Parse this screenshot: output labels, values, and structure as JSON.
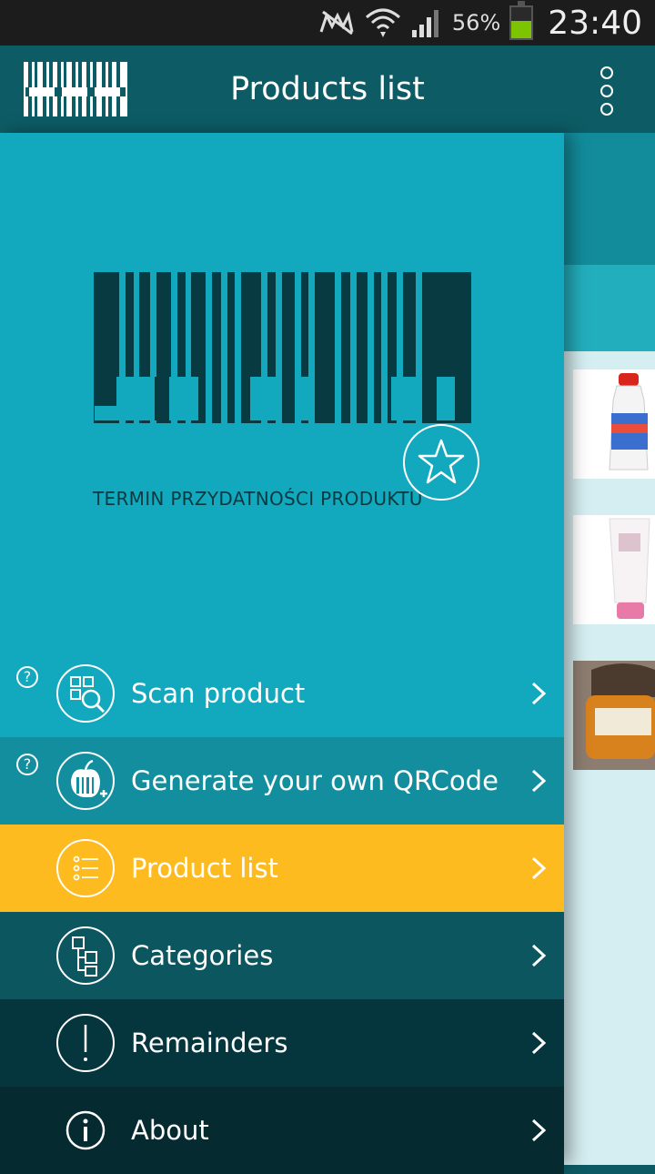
{
  "status_bar": {
    "battery_percent": "56%",
    "battery_level": 0.56,
    "time": "23:40"
  },
  "app_bar": {
    "title": "Products list",
    "overflow_icon": "more-vert-icon"
  },
  "drawer": {
    "tagline": "TERMIN PRZYDATNOŚCI PRODUKTU",
    "menu": [
      {
        "label": "Scan product",
        "icon": "qr-scan-icon",
        "help": "?",
        "bg": "#12a9bf"
      },
      {
        "label": "Generate your own QRCode",
        "icon": "apple-qr-add-icon",
        "help": "?",
        "bg": "#128e9e"
      },
      {
        "label": "Product list",
        "icon": "list-icon",
        "help": "",
        "bg": "#fdbb1f"
      },
      {
        "label": "Categories",
        "icon": "hierarchy-icon",
        "help": "",
        "bg": "#0c5660"
      },
      {
        "label": "Remainders",
        "icon": "exclamation-icon",
        "help": "",
        "bg": "#06363d"
      },
      {
        "label": "About",
        "icon": "info-icon",
        "help": "",
        "bg": "#052a30"
      }
    ]
  },
  "colors": {
    "accent": "#fdbb1f",
    "drawer_bg": "#12a9bf",
    "app_bar": "#0d5c65"
  }
}
